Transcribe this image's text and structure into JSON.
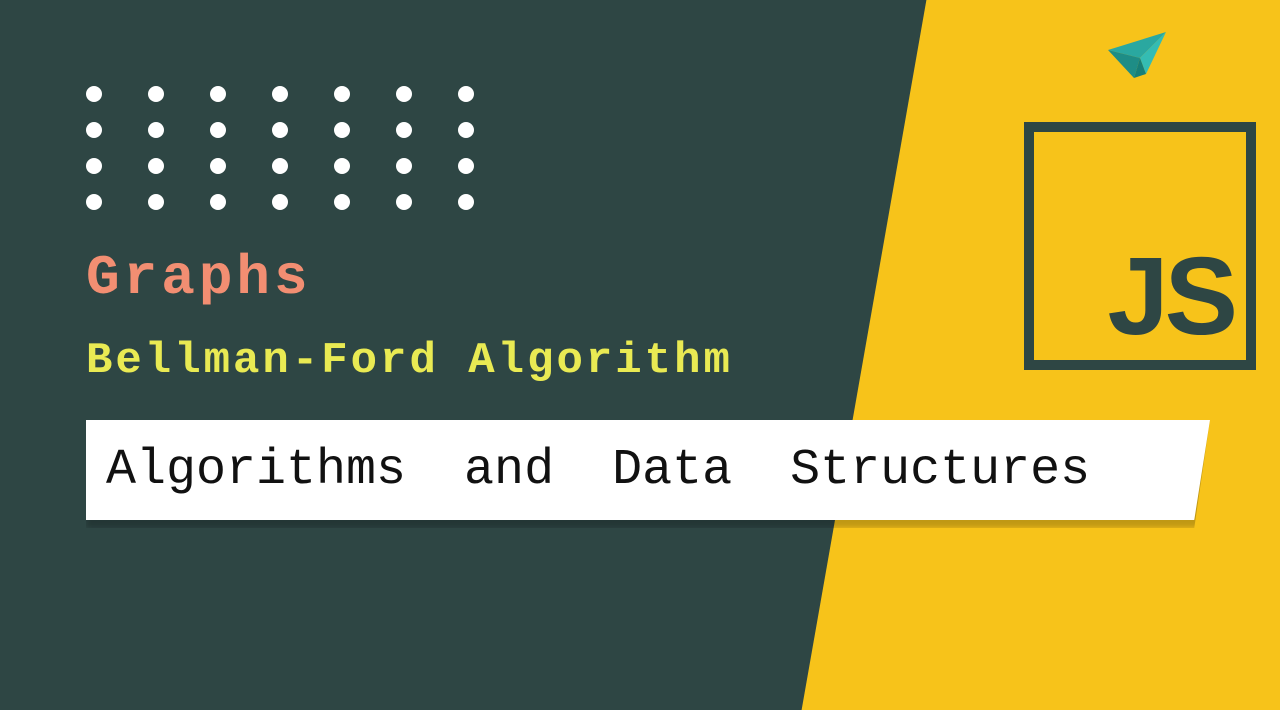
{
  "category": "Graphs",
  "subtitle": "Bellman-Ford Algorithm",
  "banner": "Algorithms and Data Structures",
  "logo": "JS",
  "dot_grid": {
    "rows": 4,
    "cols": 7
  },
  "colors": {
    "background": "#2e4644",
    "wedge": "#f7c31a",
    "dot": "#ffffff",
    "category": "#f28e72",
    "subtitle": "#e9ea53",
    "banner_bg": "#ffffff",
    "banner_text": "#111111",
    "logo_border": "#2e4644",
    "plane": "#2aa8a0"
  }
}
